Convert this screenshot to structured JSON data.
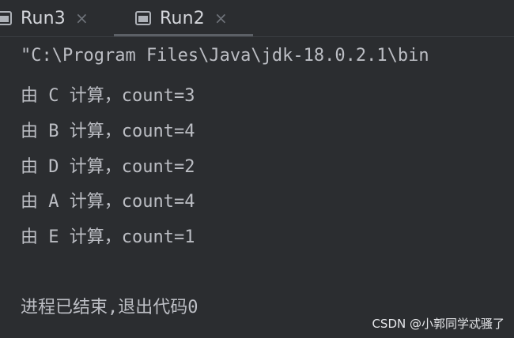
{
  "tabs": [
    {
      "label": "Run3",
      "close": "×"
    },
    {
      "label": "Run2",
      "close": "×"
    }
  ],
  "console": {
    "command": "\"C:\\Program Files\\Java\\jdk-18.0.2.1\\bin",
    "lines": [
      "由 C 计算，count=3",
      "由 B 计算，count=4",
      "由 D 计算，count=2",
      "由 A 计算，count=4",
      "由 E 计算，count=1"
    ],
    "exit_message": "进程已结束,退出代码0"
  },
  "watermark": "CSDN @小郭同学忒骚了",
  "icons": {
    "tab_icon": "console-window-icon",
    "close": "close-icon"
  },
  "colors": {
    "background": "#2b2d30",
    "text": "#bcbec4"
  }
}
